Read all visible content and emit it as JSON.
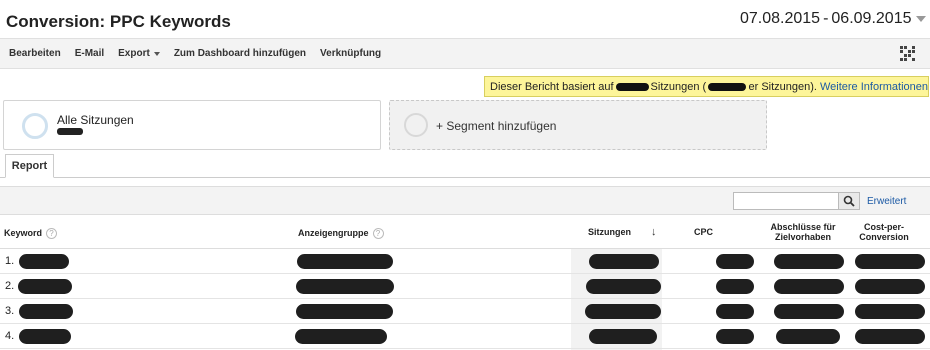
{
  "header": {
    "title": "Conversion: PPC Keywords",
    "date_start": "07.08.2015",
    "date_sep": "-",
    "date_end": "06.09.2015"
  },
  "toolbar": {
    "items": [
      "Bearbeiten",
      "E-Mail",
      "Export",
      "Zum Dashboard hinzufügen",
      "Verknüpfung"
    ],
    "icon": "qr-code-icon"
  },
  "notice": {
    "text_a": "Dieser Bericht basiert auf",
    "text_b": "Sitzungen (",
    "text_c": "er Sitzungen).",
    "link": "Weitere Informationen"
  },
  "segments": {
    "all_sessions": "Alle Sitzungen",
    "add_segment": "+ Segment hinzufügen"
  },
  "tabs": {
    "report": "Report"
  },
  "search": {
    "placeholder": "",
    "advanced": "Erweitert",
    "icon": "search-icon"
  },
  "table": {
    "columns": {
      "keyword": "Keyword",
      "ad_group": "Anzeigengruppe",
      "sessions": "Sitzungen",
      "cpc": "CPC",
      "conversions_line1": "Abschlüsse für",
      "conversions_line2": "Zielvorhaben",
      "cost_line1": "Cost-per-",
      "cost_line2": "Conversion"
    },
    "sort_indicator": "↓",
    "help_glyph": "?",
    "rows": [
      {
        "num": "1."
      },
      {
        "num": "2."
      },
      {
        "num": "3."
      },
      {
        "num": "4."
      }
    ]
  },
  "colors": {
    "notice_bg": "#fdf59a",
    "link": "#1c5aa5",
    "redaction": "#1f1f1f"
  }
}
